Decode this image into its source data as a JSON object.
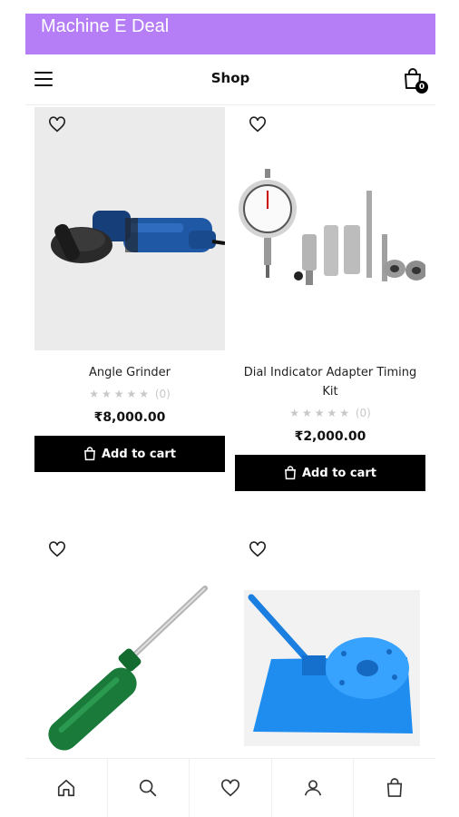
{
  "app": {
    "title": "Machine E Deal",
    "accent": "#b57df6"
  },
  "header": {
    "title": "Shop",
    "menu_icon": "hamburger-icon",
    "cart_icon": "shopping-bag-icon",
    "cart_count": "0"
  },
  "products": [
    {
      "name": "Angle Grinder",
      "rating_count": "(0)",
      "price": "₹8,000.00",
      "button": "Add to cart",
      "image": "angle-grinder-image"
    },
    {
      "name": "Dial Indicator Adapter Timing Kit",
      "rating_count": "(0)",
      "price": "₹2,000.00",
      "button": "Add to cart",
      "image": "dial-indicator-kit-image"
    },
    {
      "name": "",
      "image": "screwdriver-image"
    },
    {
      "name": "",
      "image": "bending-tool-image"
    }
  ],
  "bottom_nav": [
    "home-icon",
    "search-icon",
    "heart-icon",
    "user-icon",
    "shopping-bag-icon"
  ]
}
